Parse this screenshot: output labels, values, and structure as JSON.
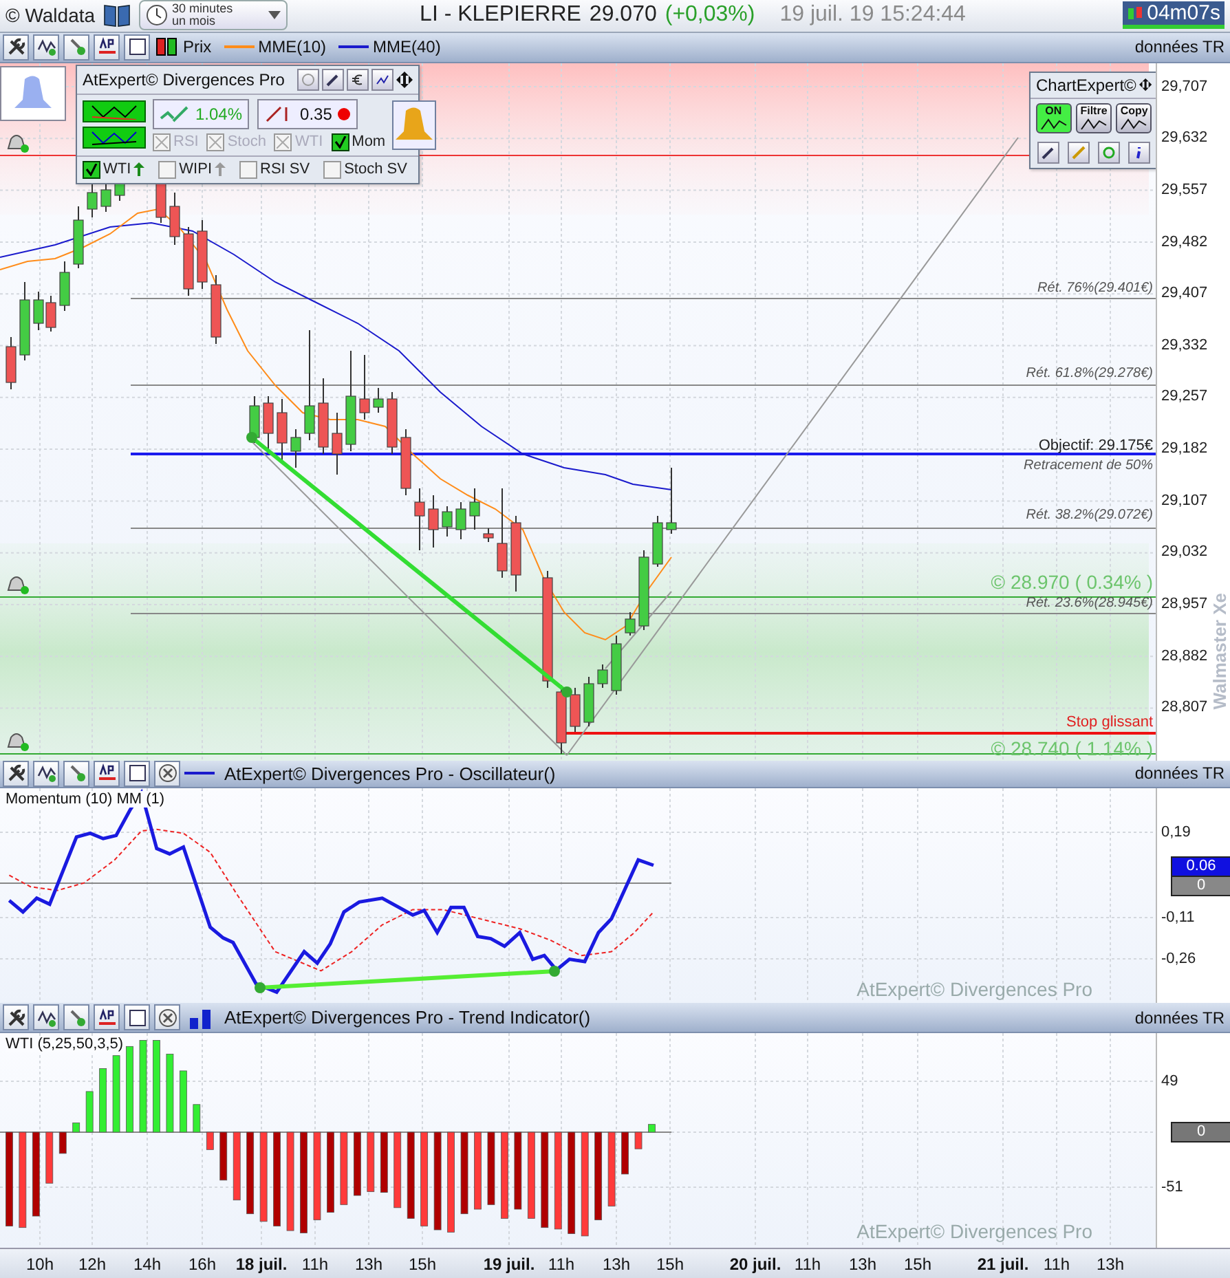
{
  "top_bar": {
    "logo": "© Waldata",
    "timeframe": {
      "line_1": "30 minutes",
      "line_2": "un mois"
    },
    "symbol": "LI - KLEPIERRE",
    "price": "29.070",
    "change": "(+0,03%)",
    "datetime": "19 juil. 19 15:24:44",
    "timer": "04m07s"
  },
  "price_toolbar": {
    "legend": [
      {
        "label": "Prix",
        "kind": "candle"
      },
      {
        "label": "MME(10)",
        "kind": "line",
        "color": "#ff8c1a"
      },
      {
        "label": "MME(40)",
        "kind": "line",
        "color": "#1a1acc"
      }
    ],
    "source": "données TR"
  },
  "divergences_panel": {
    "title": "AtExpert© Divergences Pro",
    "threshold": "1.04%",
    "ratio": "0.35",
    "filters": [
      {
        "label": "RSI",
        "checked": false,
        "disabled": true
      },
      {
        "label": "Stoch",
        "checked": false,
        "disabled": true
      },
      {
        "label": "WTI",
        "checked": false,
        "disabled": true
      },
      {
        "label": "Mom",
        "checked": true,
        "disabled": false
      }
    ],
    "trend_filters": [
      {
        "label": "WTI",
        "checked": true
      },
      {
        "label": "WIPI",
        "checked": false
      },
      {
        "label": "RSI SV",
        "checked": false
      },
      {
        "label": "Stoch SV",
        "checked": false
      }
    ]
  },
  "chart_expert": {
    "title": "ChartExpert©",
    "buttons": [
      {
        "label": "ON",
        "on": true
      },
      {
        "label": "Filtre",
        "on": false
      },
      {
        "label": "Copy",
        "on": false
      }
    ]
  },
  "price_chart": {
    "annotations": [
      {
        "text": "Rét. 76%(29.401€)",
        "kind": "retracement"
      },
      {
        "text": "Rét. 61.8%(29.278€)",
        "kind": "retracement"
      },
      {
        "text": "Objectif: 29.175€",
        "kind": "objective"
      },
      {
        "text": "Retracement de 50%",
        "kind": "retracement"
      },
      {
        "text": "Rét. 38.2%(29.072€)",
        "kind": "retracement"
      },
      {
        "text": "© 28.970 ( 0.34% )",
        "kind": "target"
      },
      {
        "text": "Rét. 23.6%(28.945€)",
        "kind": "retracement"
      },
      {
        "text": "Stop glissant",
        "kind": "stop"
      },
      {
        "text": "© 28.740 ( 1.14% )",
        "kind": "target"
      }
    ],
    "price_ticks": [
      "29,707",
      "29,632",
      "29,557",
      "29,482",
      "29,407",
      "29,332",
      "29,257",
      "29,182",
      "29,107",
      "29,032",
      "28,957",
      "28,882",
      "28,807"
    ],
    "watermark": "Walmaster Xe"
  },
  "oscillator": {
    "header": "AtExpert© Divergences Pro - Oscillateur()",
    "source": "données TR",
    "label": "Momentum (10) MM (1)",
    "ticks": [
      "0,19",
      "-0,11",
      "-0,26"
    ],
    "value_badge": "0.06",
    "zero_badge": "0",
    "watermark": "AtExpert© Divergences Pro"
  },
  "trend_indicator": {
    "header": "AtExpert© Divergences Pro - Trend Indicator()",
    "source": "données TR",
    "label": "WTI (5,25,50,3,5)",
    "ticks": [
      "49",
      "-51"
    ],
    "zero_badge": "0",
    "watermark": "AtExpert© Divergences Pro"
  },
  "time_axis": [
    {
      "label": "10h",
      "bold": false
    },
    {
      "label": "12h",
      "bold": false
    },
    {
      "label": "14h",
      "bold": false
    },
    {
      "label": "16h",
      "bold": false
    },
    {
      "label": "18 juil.",
      "bold": true
    },
    {
      "label": "11h",
      "bold": false
    },
    {
      "label": "13h",
      "bold": false
    },
    {
      "label": "15h",
      "bold": false
    },
    {
      "label": "19 juil.",
      "bold": true
    },
    {
      "label": "11h",
      "bold": false
    },
    {
      "label": "13h",
      "bold": false
    },
    {
      "label": "15h",
      "bold": false
    },
    {
      "label": "20 juil.",
      "bold": true
    },
    {
      "label": "11h",
      "bold": false
    },
    {
      "label": "13h",
      "bold": false
    },
    {
      "label": "15h",
      "bold": false
    },
    {
      "label": "21 juil.",
      "bold": true
    },
    {
      "label": "11h",
      "bold": false
    },
    {
      "label": "13h",
      "bold": false
    }
  ]
}
